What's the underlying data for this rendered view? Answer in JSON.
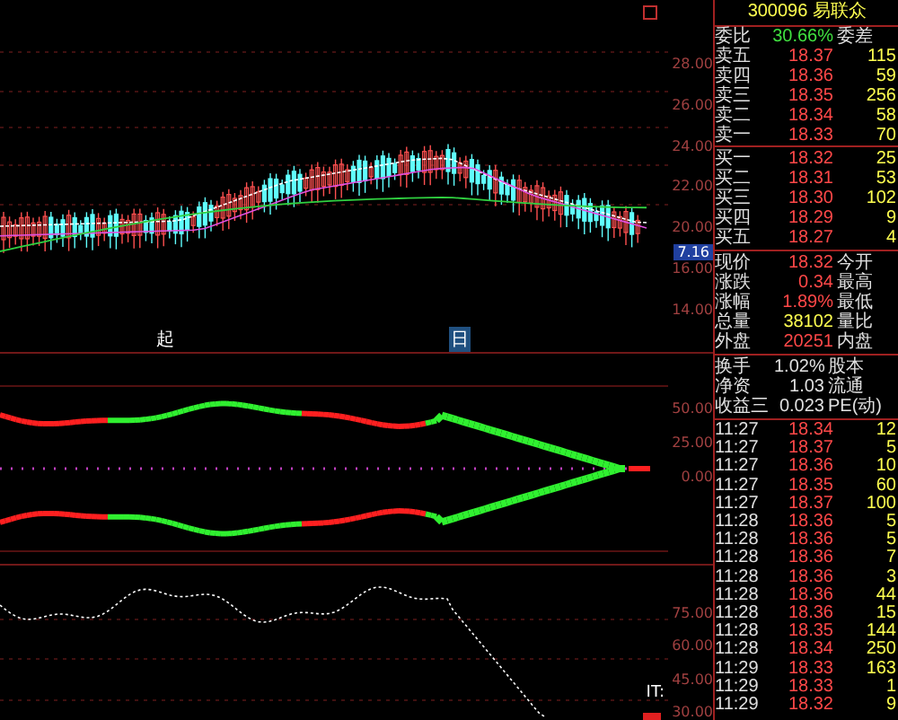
{
  "header": {
    "code": "300096",
    "name": "易联众"
  },
  "order_ratio": {
    "label": "委比",
    "value": "30.66%",
    "label2": "委差"
  },
  "asks": [
    {
      "label": "卖五",
      "price": "18.37",
      "volume": "115"
    },
    {
      "label": "卖四",
      "price": "18.36",
      "volume": "59"
    },
    {
      "label": "卖三",
      "price": "18.35",
      "volume": "256"
    },
    {
      "label": "卖二",
      "price": "18.34",
      "volume": "58"
    },
    {
      "label": "卖一",
      "price": "18.33",
      "volume": "70"
    }
  ],
  "bids": [
    {
      "label": "买一",
      "price": "18.32",
      "volume": "25"
    },
    {
      "label": "买二",
      "price": "18.31",
      "volume": "53"
    },
    {
      "label": "买三",
      "price": "18.30",
      "volume": "102"
    },
    {
      "label": "买四",
      "price": "18.29",
      "volume": "9"
    },
    {
      "label": "买五",
      "price": "18.27",
      "volume": "4"
    }
  ],
  "quote": [
    {
      "label": "现价",
      "value": "18.32",
      "label2": "今开",
      "color": "#ff4848"
    },
    {
      "label": "涨跌",
      "value": "0.34",
      "label2": "最高",
      "color": "#ff4848"
    },
    {
      "label": "涨幅",
      "value": "1.89%",
      "label2": "最低",
      "color": "#ff4848"
    },
    {
      "label": "总量",
      "value": "38102",
      "label2": "量比",
      "color": "#ffff50"
    },
    {
      "label": "外盘",
      "value": "20251",
      "label2": "内盘",
      "color": "#ff4848"
    }
  ],
  "fundamentals": [
    {
      "label": "换手",
      "value": "1.02%",
      "label2": "股本"
    },
    {
      "label": "净资",
      "value": "1.03",
      "label2": "流通"
    },
    {
      "label": "收益三",
      "value": "0.023",
      "label2": "PE(动)"
    }
  ],
  "ticks": [
    {
      "time": "11:27",
      "price": "18.34",
      "volume": "12"
    },
    {
      "time": "11:27",
      "price": "18.37",
      "volume": "5"
    },
    {
      "time": "11:27",
      "price": "18.36",
      "volume": "10"
    },
    {
      "time": "11:27",
      "price": "18.35",
      "volume": "60"
    },
    {
      "time": "11:27",
      "price": "18.37",
      "volume": "100"
    },
    {
      "time": "11:28",
      "price": "18.36",
      "volume": "5"
    },
    {
      "time": "11:28",
      "price": "18.36",
      "volume": "5"
    },
    {
      "time": "11:28",
      "price": "18.36",
      "volume": "7"
    },
    {
      "time": "11:28",
      "price": "18.36",
      "volume": "3"
    },
    {
      "time": "11:28",
      "price": "18.36",
      "volume": "44"
    },
    {
      "time": "11:28",
      "price": "18.36",
      "volume": "15"
    },
    {
      "time": "11:28",
      "price": "18.35",
      "volume": "144"
    },
    {
      "time": "11:28",
      "price": "18.34",
      "volume": "250"
    },
    {
      "time": "11:29",
      "price": "18.33",
      "volume": "163"
    },
    {
      "time": "11:29",
      "price": "18.33",
      "volume": "1"
    },
    {
      "time": "11:29",
      "price": "18.32",
      "volume": "9"
    }
  ],
  "price_axis": [
    "28.00",
    "26.00",
    "24.00",
    "22.00",
    "20.00",
    "16.00",
    "14.00"
  ],
  "current_price_tag": "7.16",
  "markers": [
    "起",
    "日"
  ],
  "indicator_axis": [
    "50.00",
    "25.00",
    "0.00"
  ],
  "oscillator_axis": [
    "75.00",
    "60.00",
    "45.00",
    "30.00"
  ],
  "oscillator_label": "IT:"
}
